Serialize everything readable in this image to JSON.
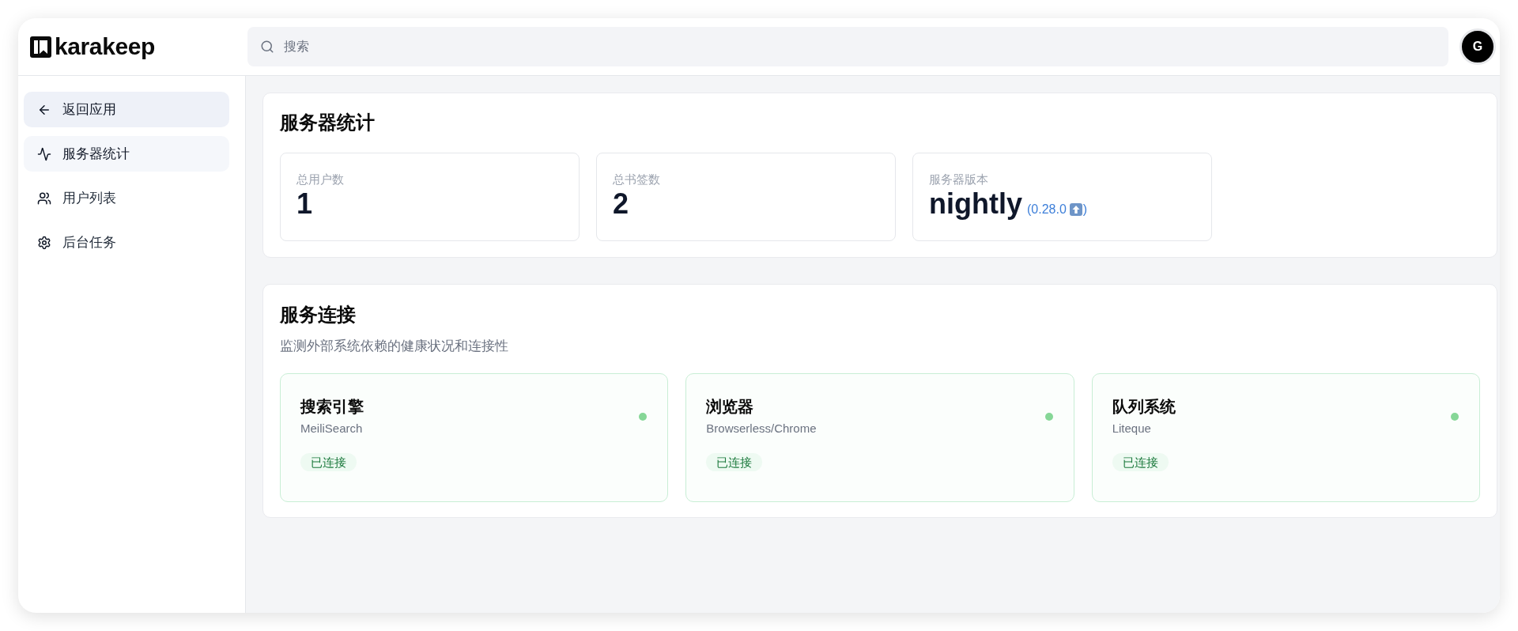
{
  "header": {
    "brand": "karakeep",
    "search": {
      "placeholder": "搜索"
    },
    "avatar": {
      "initial": "G"
    }
  },
  "sidebar": {
    "back": {
      "label": "返回应用"
    },
    "items": [
      {
        "label": "服务器统计",
        "selected": true
      },
      {
        "label": "用户列表",
        "selected": false
      },
      {
        "label": "后台任务",
        "selected": false
      }
    ]
  },
  "stats": {
    "title": "服务器统计",
    "cards": [
      {
        "label": "总用户数",
        "value": "1"
      },
      {
        "label": "总书签数",
        "value": "2"
      },
      {
        "label": "服务器版本",
        "value": "nightly",
        "latest": {
          "text_before": "(0.28.0",
          "text_after": ")",
          "update_available": true
        }
      }
    ]
  },
  "services": {
    "title": "服务连接",
    "description": "监测外部系统依赖的健康状况和连接性",
    "items": [
      {
        "name": "搜索引擎",
        "backend": "MeiliSearch",
        "status": "已连接",
        "healthy": true
      },
      {
        "name": "浏览器",
        "backend": "Browserless/Chrome",
        "status": "已连接",
        "healthy": true
      },
      {
        "name": "队列系统",
        "backend": "Liteque",
        "status": "已连接",
        "healthy": true
      }
    ]
  }
}
